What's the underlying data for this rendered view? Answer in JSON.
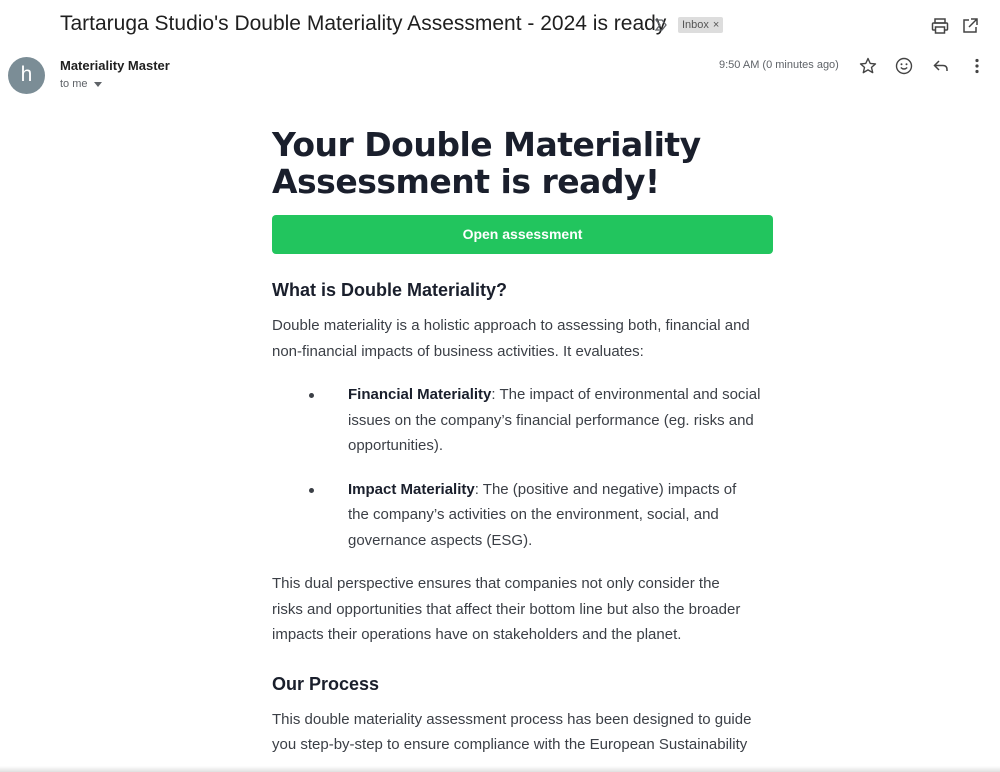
{
  "email": {
    "subject": "Tartaruga Studio's Double Materiality Assessment - 2024 is ready",
    "label": "Inbox",
    "label_remove": "×",
    "sender_initial": "h",
    "sender_name": "Materiality Master",
    "recipient": "to me",
    "time": "9:50 AM (0 minutes ago)"
  },
  "icons": {
    "print": "print-icon",
    "open_new_window": "open-in-new-window-icon",
    "star": "star-icon",
    "emoji": "emoji-icon",
    "reply": "reply-icon",
    "more": "more-vert-icon",
    "important": "important-marker-icon"
  },
  "body": {
    "hero_line1": "Your Double Materiality",
    "hero_line2": "Assessment is ready!",
    "cta_label": "Open assessment",
    "section1_title": "What is Double Materiality?",
    "intro_line1": "Double materiality is a holistic approach to assessing both, financial and",
    "intro_line2": "non-financial impacts of business activities. It evaluates:",
    "bullets": [
      {
        "term": "Financial Materiality",
        "lines": [
          ": The impact of environmental and social",
          "issues on the company’s financial performance (eg. risks and",
          "opportunities)."
        ]
      },
      {
        "term": "Impact Materiality",
        "lines": [
          ": The (positive and negative) impacts of",
          "the company’s activities on the environment, social, and",
          "governance aspects (ESG)."
        ]
      }
    ],
    "dual_line1": "This dual perspective ensures that companies not only consider the",
    "dual_line2": "risks and opportunities that affect their bottom line but also the broader",
    "dual_line3": "impacts their operations have on stakeholders and the planet.",
    "section2_title": "Our Process",
    "process_line1": "This double materiality assessment process has been designed to guide",
    "process_line2": "you step-by-step to ensure compliance with the European Sustainability"
  },
  "colors": {
    "cta_green": "#22c55e",
    "avatar": "#7b8d96",
    "heading": "#1a1f2c",
    "text": "#3b3f46"
  }
}
